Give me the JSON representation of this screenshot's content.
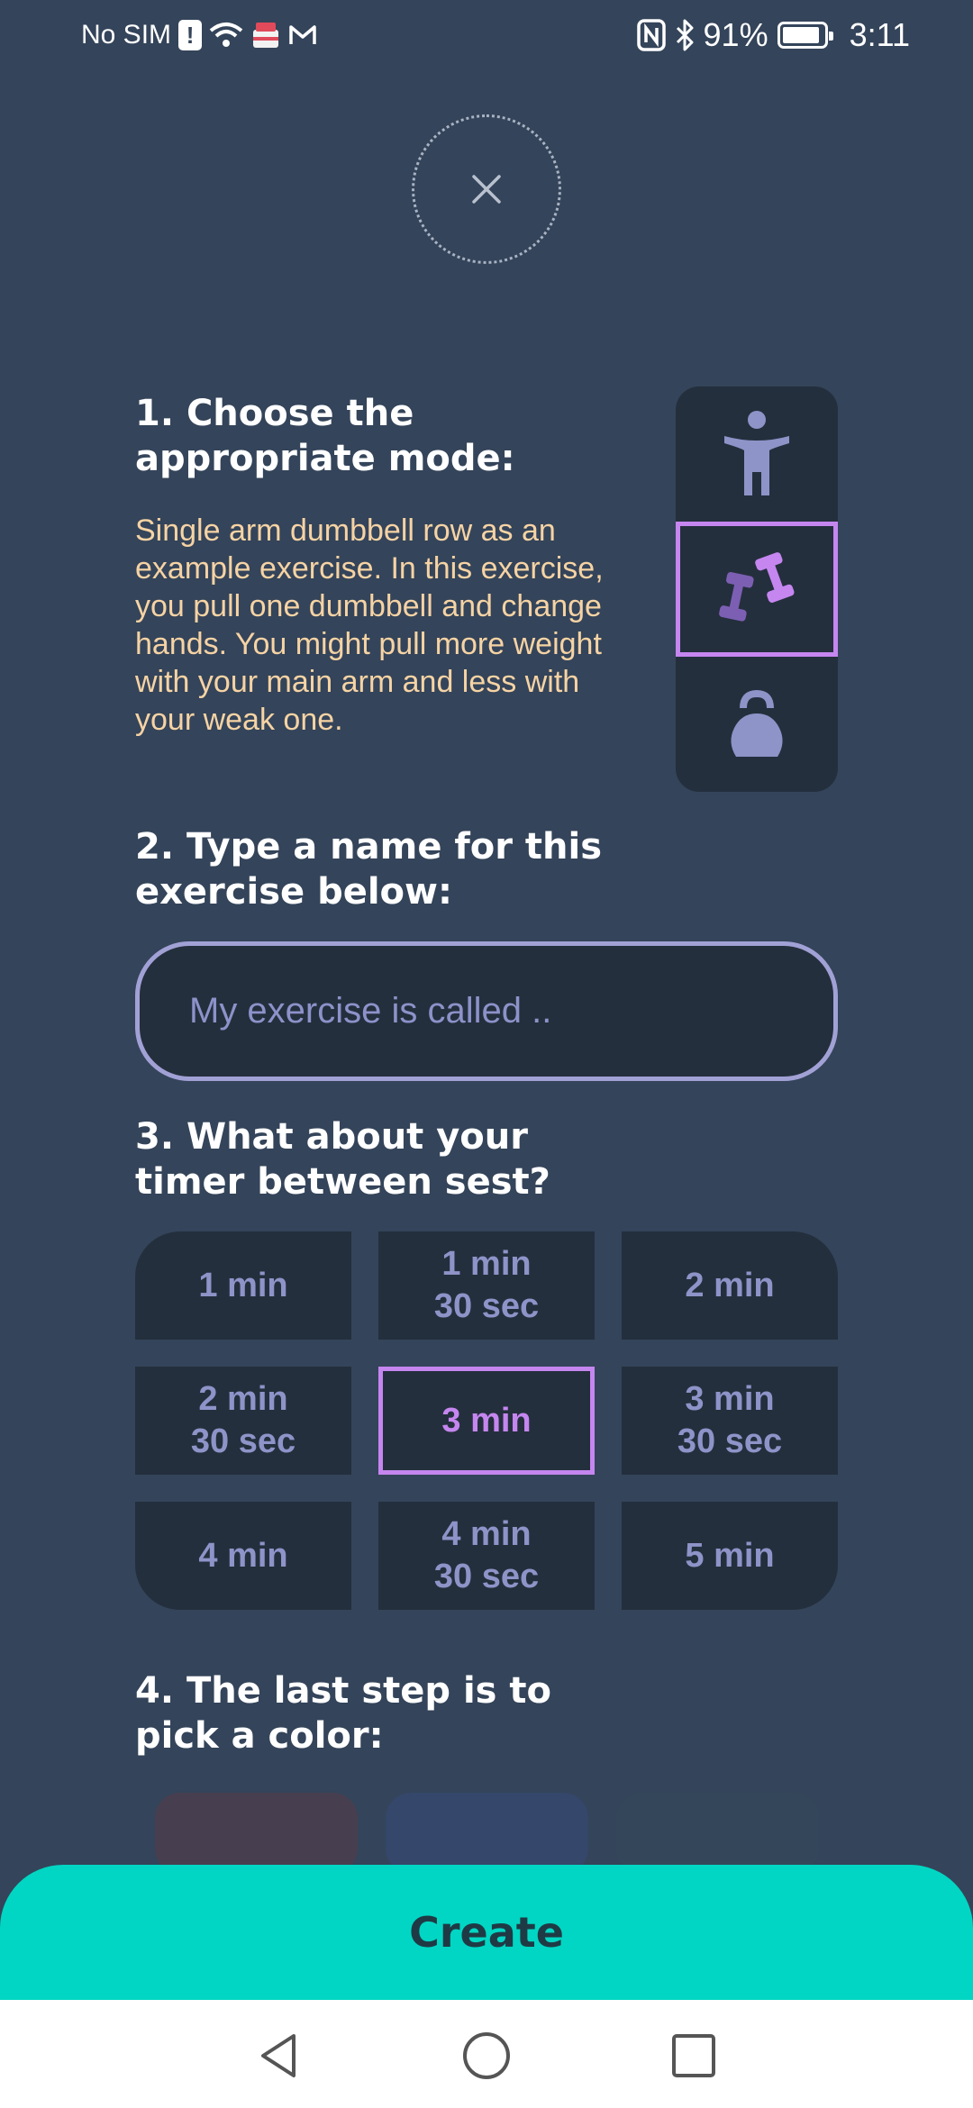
{
  "status_bar": {
    "carrier": "No SIM",
    "battery_percent": "91%",
    "battery_level": 0.91,
    "time": "3:11"
  },
  "close": {
    "icon": "close-icon"
  },
  "step1": {
    "title": "1. Choose the appropriate mode:",
    "description": "Single arm dumbbell row as an example exercise. In this exercise, you pull one dumbbell and change hands. You might pull more weight with your main arm and less with your weak one.",
    "modes": [
      {
        "icon": "bodyweight-person-icon",
        "selected": false
      },
      {
        "icon": "dumbbells-icon",
        "selected": true
      },
      {
        "icon": "kettlebell-icon",
        "selected": false
      }
    ]
  },
  "step2": {
    "title": "2. Type a name for this exercise below:",
    "input_placeholder": "My exercise is called ..",
    "input_value": ""
  },
  "step3": {
    "title": "3. What about your timer between sest?",
    "options": [
      {
        "label": "1 min",
        "selected": false
      },
      {
        "label": "1 min\n30 sec",
        "selected": false
      },
      {
        "label": "2 min",
        "selected": false
      },
      {
        "label": "2 min\n30 sec",
        "selected": false
      },
      {
        "label": "3 min",
        "selected": true
      },
      {
        "label": "3 min\n30 sec",
        "selected": false
      },
      {
        "label": "4 min",
        "selected": false
      },
      {
        "label": "4 min\n30 sec",
        "selected": false
      },
      {
        "label": "5 min",
        "selected": false
      }
    ]
  },
  "step4": {
    "title": "4. The last step is to pick a color:",
    "swatches": [
      "#473f4f",
      "#35476a",
      "#34475a"
    ]
  },
  "create_button": {
    "label": "Create"
  },
  "colors": {
    "background": "#34445a",
    "panel": "#242f3d",
    "accent_purple": "#c586f0",
    "text_muted": "#8e93c8",
    "description_text": "#f6d3a4",
    "create_teal": "#00d6c3"
  }
}
